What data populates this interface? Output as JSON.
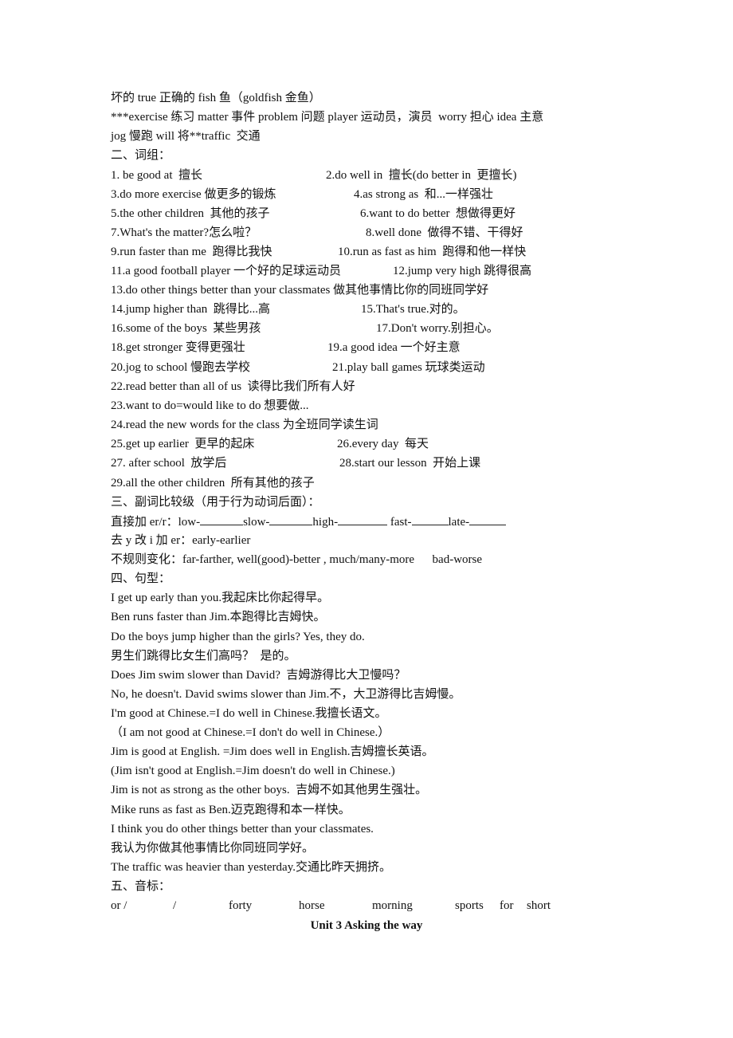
{
  "vocab_lines": [
    "坏的 true 正确的 fish 鱼（goldfish 金鱼）",
    "***exercise 练习 matter 事件 problem 问题 player 运动员，演员  worry 担心 idea 主意",
    "jog 慢跑 will 将**traffic  交通"
  ],
  "phrases": {
    "heading": "二、词组：",
    "rows": [
      {
        "left": "1. be good at  擅长",
        "right": "2.do well in  擅长(do better in  更擅长)"
      },
      {
        "left": "3.do more exercise 做更多的锻炼",
        "right": "4.as strong as  和...一样强壮"
      },
      {
        "left": "5.the other children  其他的孩子",
        "right": "6.want to do better  想做得更好"
      },
      {
        "left": "7.What's the matter?怎么啦？",
        "right": "8.well done  做得不错、干得好"
      },
      {
        "left": "9.run faster than me  跑得比我快",
        "right": "10.run as fast as him  跑得和他一样快"
      },
      {
        "left": "11.a good football player 一个好的足球运动员",
        "right": "12.jump very high 跳得很高"
      },
      {
        "left": "13.do other things better than your classmates 做其他事情比你的同班同学好",
        "right": ""
      },
      {
        "left": "14.jump higher than  跳得比...高",
        "right": "15.That's true.对的。"
      },
      {
        "left": "16.some of the boys  某些男孩",
        "right": "17.Don't worry.别担心。"
      },
      {
        "left": "18.get stronger 变得更强壮",
        "right": "19.a good idea 一个好主意"
      },
      {
        "left": "20.jog to school 慢跑去学校",
        "right": "21.play ball games 玩球类运动"
      },
      {
        "left": "22.read better than all of us  读得比我们所有人好",
        "right": ""
      },
      {
        "left": "23.want to do=would like to do 想要做...",
        "right": ""
      },
      {
        "left": "24.read the new words for the class 为全班同学读生词",
        "right": ""
      },
      {
        "left": "25.get up earlier  更早的起床",
        "right": "26.every day  每天"
      },
      {
        "left": "27. after school  放学后",
        "right": "28.start our lesson  开始上课"
      },
      {
        "left": "29.all the other children  所有其他的孩子",
        "right": ""
      }
    ]
  },
  "comparatives": {
    "heading": "三、副词比较级（用于行为动词后面）：",
    "rule1_prefix": "直接加 er/r：",
    "rule1_items": [
      "low-",
      "slow-",
      "high-",
      "fast-",
      "late-"
    ],
    "rule2": "去 y 改 i 加 er：early-earlier",
    "rule3": "不规则变化：far-farther, well(good)-better , much/many-more      bad-worse"
  },
  "sentences": {
    "heading": "四、句型：",
    "lines": [
      "I get up early than you.我起床比你起得早。",
      "Ben runs faster than Jim.本跑得比吉姆快。",
      "Do the boys jump higher than the girls? Yes, they do.",
      "男生们跳得比女生们高吗？  是的。",
      "Does Jim swim slower than David?  吉姆游得比大卫慢吗？",
      "No, he doesn't. David swims slower than Jim.不，大卫游得比吉姆慢。",
      "I'm good at Chinese.=I do well in Chinese.我擅长语文。",
      "（I am not good at Chinese.=I don't do well in Chinese.）",
      "Jim is good at English. =Jim does well in English.吉姆擅长英语。",
      "(Jim isn't good at English.=Jim doesn't do well in Chinese.)",
      "Jim is not as strong as the other boys.  吉姆不如其他男生强壮。",
      "Mike runs as fast as Ben.迈克跑得和本一样快。",
      "I think you do other things better than your classmates.",
      "我认为你做其他事情比你同班同学好。",
      "The traffic was heavier than yesterday.交通比昨天拥挤。"
    ]
  },
  "phonetics": {
    "heading": "五、音标：",
    "words": [
      "or /",
      "/",
      "forty",
      "horse",
      "morning",
      "sports",
      "for",
      "short"
    ]
  },
  "unit_title": "Unit 3 Asking the way"
}
